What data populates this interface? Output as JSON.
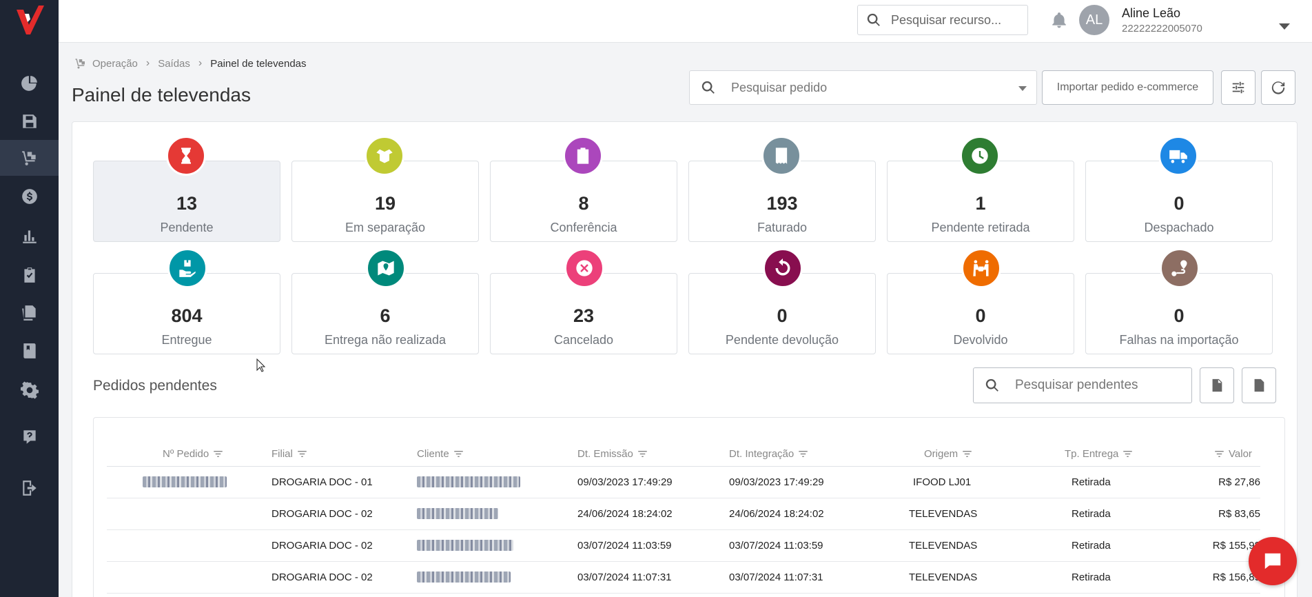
{
  "header": {
    "search_placeholder": "Pesquisar recurso...",
    "user": {
      "initials": "AL",
      "name": "Aline Leão",
      "id": "22222222005070"
    }
  },
  "breadcrumb": {
    "items": [
      "Operação",
      "Saídas",
      "Painel de televendas"
    ]
  },
  "page": {
    "title": "Painel de televendas",
    "order_search_placeholder": "Pesquisar pedido",
    "import_label": "Importar pedido e-commerce"
  },
  "stats": [
    {
      "value": "13",
      "label": "Pendente",
      "color": "#e53935",
      "icon": "hourglass-icon"
    },
    {
      "value": "19",
      "label": "Em separação",
      "color": "#c0ca33",
      "icon": "open-box-icon"
    },
    {
      "value": "8",
      "label": "Conferência",
      "color": "#ab47bc",
      "icon": "clipboard-list-icon"
    },
    {
      "value": "193",
      "label": "Faturado",
      "color": "#78909c",
      "icon": "receipt-icon"
    },
    {
      "value": "1",
      "label": "Pendente retirada",
      "color": "#2e7d32",
      "icon": "clock-icon"
    },
    {
      "value": "0",
      "label": "Despachado",
      "color": "#1e88e5",
      "icon": "truck-icon"
    },
    {
      "value": "804",
      "label": "Entregue",
      "color": "#0097a7",
      "icon": "hand-box-icon"
    },
    {
      "value": "6",
      "label": "Entrega não realizada",
      "color": "#00897b",
      "icon": "map-icon"
    },
    {
      "value": "23",
      "label": "Cancelado",
      "color": "#ec407a",
      "icon": "x-circle-icon"
    },
    {
      "value": "0",
      "label": "Pendente devolução",
      "color": "#880e4f",
      "icon": "undo-icon"
    },
    {
      "value": "0",
      "label": "Devolvido",
      "color": "#ef6c00",
      "icon": "people-carry-icon"
    },
    {
      "value": "0",
      "label": "Falhas na importação",
      "color": "#8d6e63",
      "icon": "route-icon"
    }
  ],
  "pending": {
    "title": "Pedidos pendentes",
    "search_placeholder": "Pesquisar pendentes",
    "columns": [
      "Nº Pedido",
      "Filial",
      "Cliente",
      "Dt. Emissão",
      "Dt. Integração",
      "Origem",
      "Tp. Entrega",
      "Valor"
    ],
    "rows": [
      {
        "filial": "DROGARIA DOC - 01",
        "emissao": "09/03/2023 17:49:29",
        "integracao": "09/03/2023 17:49:29",
        "origem": "IFOOD LJ01",
        "entrega": "Retirada",
        "valor": "R$ 27,86"
      },
      {
        "filial": "DROGARIA DOC - 02",
        "emissao": "24/06/2024 18:24:02",
        "integracao": "24/06/2024 18:24:02",
        "origem": "TELEVENDAS",
        "entrega": "Retirada",
        "valor": "R$ 83,65"
      },
      {
        "filial": "DROGARIA DOC - 02",
        "emissao": "03/07/2024 11:03:59",
        "integracao": "03/07/2024 11:03:59",
        "origem": "TELEVENDAS",
        "entrega": "Retirada",
        "valor": "R$ 155,98"
      },
      {
        "filial": "DROGARIA DOC - 02",
        "emissao": "03/07/2024 11:07:31",
        "integracao": "03/07/2024 11:07:31",
        "origem": "TELEVENDAS",
        "entrega": "Retirada",
        "valor": "R$ 156,89"
      }
    ]
  },
  "colors": {
    "sidebar": "#1e2533",
    "brand": "#e32b2b"
  }
}
